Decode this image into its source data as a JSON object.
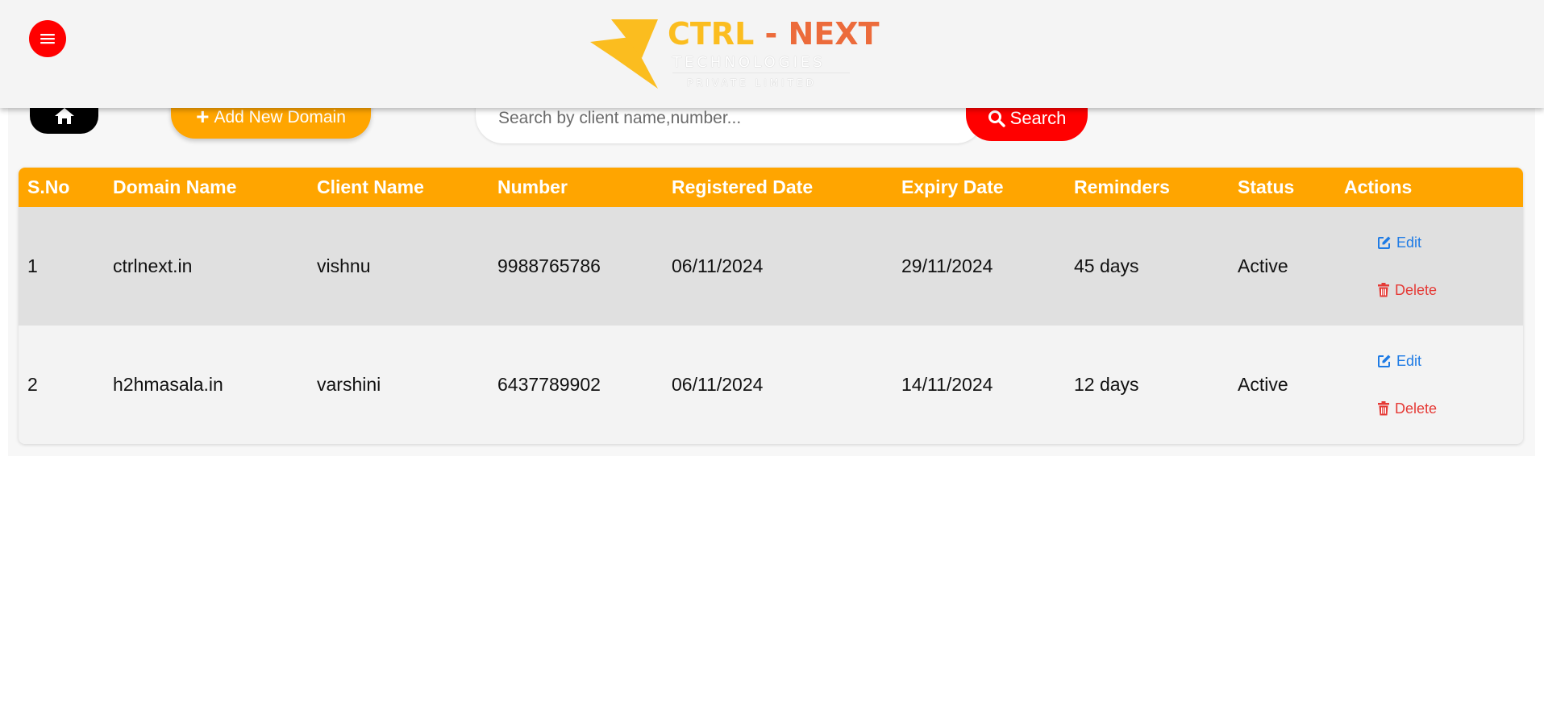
{
  "header": {
    "menu_icon": "hamburger-icon",
    "logo": {
      "ctrl": "CTRL",
      "dash": "-",
      "next": "NEXT",
      "subtitle": "TECHNOLOGIES",
      "tagline": "PRIVATE LIMITED"
    }
  },
  "toolbar": {
    "home_icon": "home-icon",
    "add_label": "Add New Domain",
    "search_placeholder": "Search by client name,number...",
    "search_label": "Search"
  },
  "colors": {
    "accent": "#ffa500",
    "danger": "#ff0000",
    "edit": "#1e7be5",
    "delete": "#e53935"
  },
  "table": {
    "columns": [
      "S.No",
      "Domain Name",
      "Client Name",
      "Number",
      "Registered Date",
      "Expiry Date",
      "Reminders",
      "Status",
      "Actions"
    ],
    "rows": [
      {
        "sno": "1",
        "domain": "ctrlnext.in",
        "client": "vishnu",
        "number": "9988765786",
        "registered": "06/11/2024",
        "expiry": "29/11/2024",
        "reminders": "45 days",
        "status": "Active",
        "edit": "Edit",
        "delete": "Delete"
      },
      {
        "sno": "2",
        "domain": "h2hmasala.in",
        "client": "varshini",
        "number": "6437789902",
        "registered": "06/11/2024",
        "expiry": "14/11/2024",
        "reminders": "12 days",
        "status": "Active",
        "edit": "Edit",
        "delete": "Delete"
      }
    ]
  }
}
